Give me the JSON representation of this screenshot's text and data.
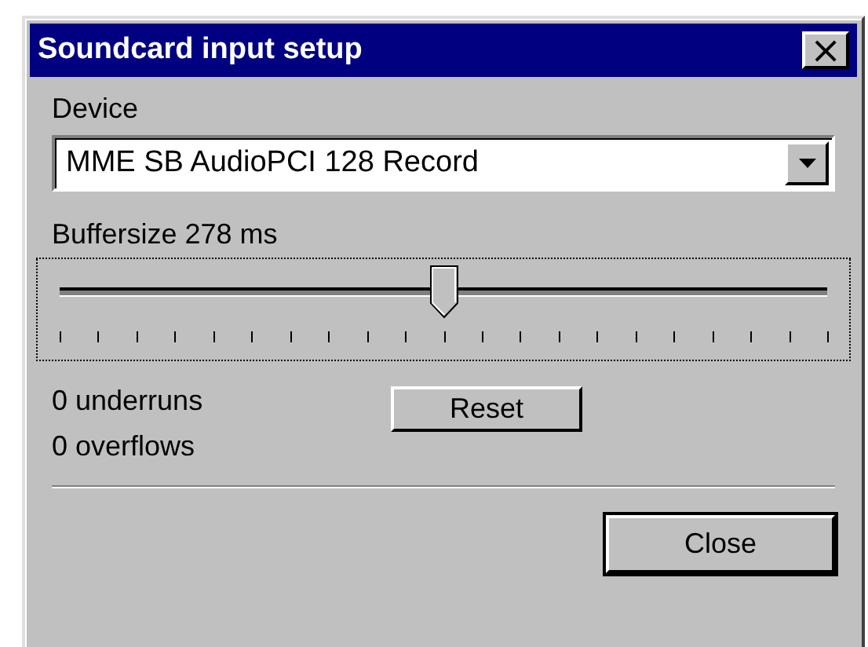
{
  "window": {
    "title": "Soundcard input setup",
    "close_glyph": "×"
  },
  "device": {
    "label": "Device",
    "value": "MME SB AudioPCI 128 Record"
  },
  "buffer": {
    "label": "Buffersize 278 ms",
    "level": 0.5
  },
  "stats": [
    {
      "text": "0 underruns"
    },
    {
      "text": "0 overflows"
    }
  ],
  "buttons": [
    {
      "label": "Reset",
      "default": false
    },
    {
      "label": "Close",
      "default": true
    }
  ]
}
